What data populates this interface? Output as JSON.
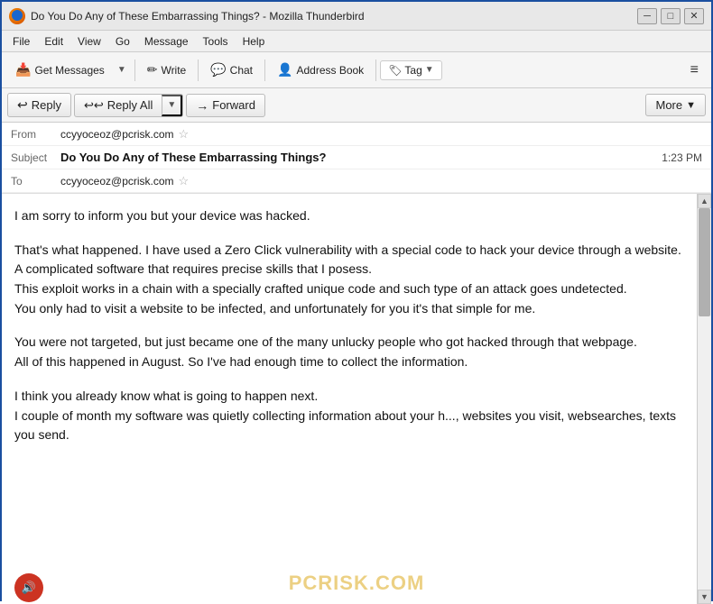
{
  "window": {
    "title": "Do You Do Any of These Embarrassing Things? - Mozilla Thunderbird",
    "icon": "thunderbird-icon"
  },
  "title_controls": {
    "minimize": "─",
    "maximize": "□",
    "close": "✕"
  },
  "menu": {
    "items": [
      "File",
      "Edit",
      "View",
      "Go",
      "Message",
      "Tools",
      "Help"
    ]
  },
  "toolbar": {
    "get_messages_label": "Get Messages",
    "write_label": "Write",
    "chat_label": "Chat",
    "address_book_label": "Address Book",
    "tag_label": "Tag",
    "hamburger": "≡"
  },
  "action_bar": {
    "reply_label": "Reply",
    "reply_all_label": "Reply All",
    "forward_label": "Forward",
    "more_label": "More"
  },
  "email": {
    "from_label": "From",
    "from_value": "ccyyoceoz@pcrisk.com",
    "subject_label": "Subject",
    "subject_value": "Do You Do Any of These Embarrassing Things?",
    "to_label": "To",
    "to_value": "ccyyoceoz@pcrisk.com",
    "time": "1:23 PM",
    "body_paragraphs": [
      "I am sorry to inform you but your device was hacked.",
      "That's what happened. I have used a Zero Click vulnerability with a special code to hack your device through a website.\nA complicated software that requires precise skills that I posess.\nThis exploit works in a chain with a specially crafted unique code and such type of an attack goes undetected.\nYou only had to visit a website to be infected, and unfortunately for you it's that simple for me.",
      "You were not targeted, but just became one of the many unlucky people who got hacked through that webpage.\nAll of this happened in August. So I've had enough time to collect the information.",
      "I think you already know what is going to happen next.\nI couple of month my software was quietly collecting information about your h..., websites you visit, websearches, texts you send."
    ]
  },
  "watermark": {
    "text": "PCRISK.COM"
  },
  "icons": {
    "reply": "↩",
    "reply_all": "↩↩",
    "forward": "→",
    "get_messages": "📥",
    "write": "✏",
    "chat": "💬",
    "address_book": "👤",
    "tag": "🏷",
    "star": "☆",
    "speaker": "🔊"
  }
}
